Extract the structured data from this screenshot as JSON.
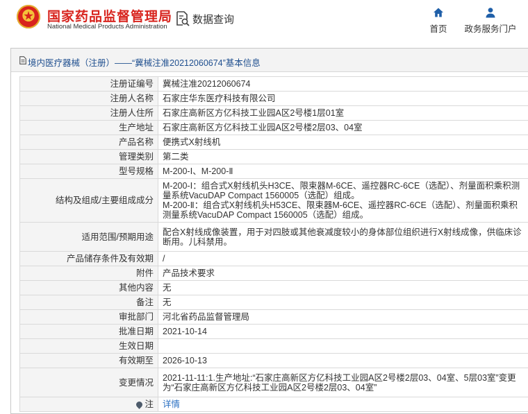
{
  "header": {
    "brand_cn": "国家药品监督管理局",
    "brand_en": "National Medical Products Administration",
    "data_query_label": "数据查询",
    "nav": {
      "home_label": "首页",
      "services_label": "政务服务门户"
    },
    "accent": "#d8231d",
    "nav_icon_color": "#1f5fa8"
  },
  "breadcrumb": {
    "text": "境内医疗器械（注册）——“冀械注准20212060674”基本信息"
  },
  "record": [
    {
      "label": "注册证编号",
      "value": "冀械注准20212060674"
    },
    {
      "label": "注册人名称",
      "value": "石家庄华东医疗科技有限公司"
    },
    {
      "label": "注册人住所",
      "value": "石家庄高新区方亿科技工业园A区2号楼1层01室"
    },
    {
      "label": "生产地址",
      "value": "石家庄高新区方亿科技工业园A区2号楼2层03、04室"
    },
    {
      "label": "产品名称",
      "value": "便携式X射线机"
    },
    {
      "label": "管理类别",
      "value": "第二类"
    },
    {
      "label": "型号规格",
      "value": "M-200-Ⅰ、M-200-Ⅱ"
    },
    {
      "label": "结构及组成/主要组成成分",
      "value": "M-200-Ⅰ：组合式X射线机头H3CE、限束器M-6CE、遥控器RC-6CE（选配）、剂量面积乘积测量系统VacuDAP Compact 1560005（选配）组成。\nM-200-Ⅱ：组合式X射线机头H53CE、限束器M-6CE、遥控器RC-6CE（选配）、剂量面积乘积测量系统VacuDAP Compact 1560005（选配）组成。"
    },
    {
      "label": "适用范围/预期用途",
      "value": "配合X射线成像装置，用于对四肢或其他衰减度较小的身体部位组织进行X射线成像，供临床诊断用。儿科禁用。"
    },
    {
      "label": "产品储存条件及有效期",
      "value": "/"
    },
    {
      "label": "附件",
      "value": "产品技术要求"
    },
    {
      "label": "其他内容",
      "value": "无"
    },
    {
      "label": "备注",
      "value": "无"
    },
    {
      "label": "审批部门",
      "value": "河北省药品监督管理局"
    },
    {
      "label": "批准日期",
      "value": "2021-10-14"
    },
    {
      "label": "生效日期",
      "value": ""
    },
    {
      "label": "有效期至",
      "value": "2026-10-13"
    },
    {
      "label": "变更情况",
      "value": "2021-11-11:1.生产地址:“石家庄高新区方亿科技工业园A区2号楼2层03、04室、5层03室”变更为“石家庄高新区方亿科技工业园A区2号楼2层03、04室”"
    }
  ],
  "note": {
    "label": "注",
    "link_text": "详情"
  }
}
